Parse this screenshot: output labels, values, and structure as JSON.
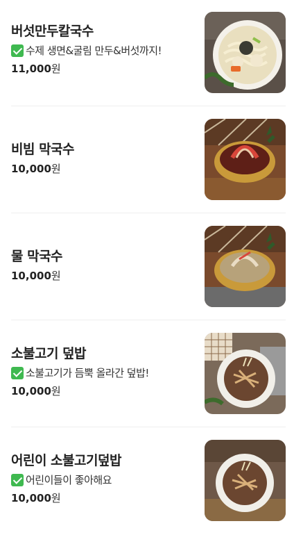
{
  "menu": {
    "items": [
      {
        "name": "버섯만두칼국수",
        "description": "수제 생면&굴림 만두&버섯까지!",
        "price_number": "11,000",
        "currency": "원",
        "image_icon": "kalguksu-bowl-photo",
        "has_check_emoji": true
      },
      {
        "name": "비빔 막국수",
        "description": "",
        "price_number": "10,000",
        "currency": "원",
        "image_icon": "bibim-makguksu-photo",
        "has_check_emoji": false
      },
      {
        "name": "물 막국수",
        "description": "",
        "price_number": "10,000",
        "currency": "원",
        "image_icon": "mul-makguksu-photo",
        "has_check_emoji": false
      },
      {
        "name": "소불고기 덮밥",
        "description": "소불고기가 듬뿍 올라간 덮밥!",
        "price_number": "10,000",
        "currency": "원",
        "image_icon": "bulgogi-rice-bowl-photo",
        "has_check_emoji": true
      },
      {
        "name": "어린이 소불고기덮밥",
        "description": "어린이들이 좋아해요",
        "price_number": "10,000",
        "currency": "원",
        "image_icon": "kids-bulgogi-rice-bowl-photo",
        "has_check_emoji": true
      }
    ]
  },
  "colors": {
    "text": "#222222",
    "divider": "#efefef",
    "check": "#3fb950"
  }
}
